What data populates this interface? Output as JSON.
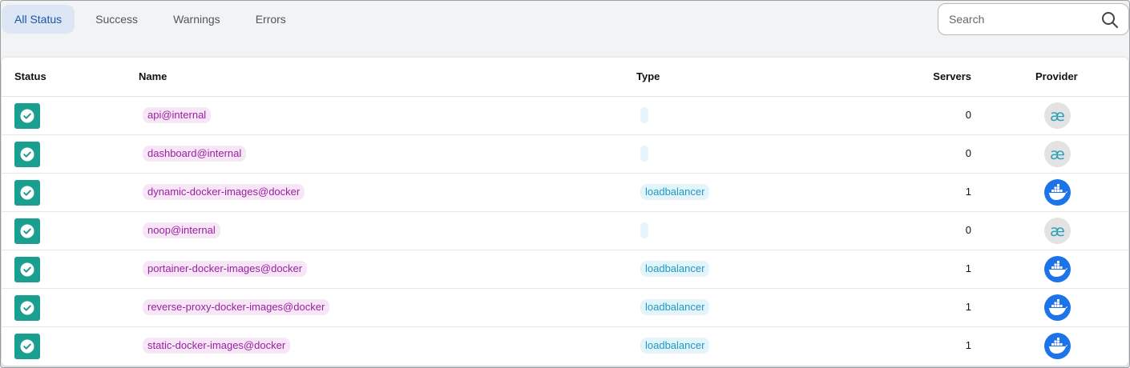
{
  "tabs": [
    {
      "label": "All Status",
      "active": true
    },
    {
      "label": "Success",
      "active": false
    },
    {
      "label": "Warnings",
      "active": false
    },
    {
      "label": "Errors",
      "active": false
    }
  ],
  "search": {
    "placeholder": "Search",
    "value": ""
  },
  "table": {
    "headers": {
      "status": "Status",
      "name": "Name",
      "type": "Type",
      "servers": "Servers",
      "provider": "Provider"
    },
    "rows": [
      {
        "status": "success",
        "name": "api@internal",
        "type": "",
        "servers": "0",
        "provider": "internal"
      },
      {
        "status": "success",
        "name": "dashboard@internal",
        "type": "",
        "servers": "0",
        "provider": "internal"
      },
      {
        "status": "success",
        "name": "dynamic-docker-images@docker",
        "type": "loadbalancer",
        "servers": "1",
        "provider": "docker"
      },
      {
        "status": "success",
        "name": "noop@internal",
        "type": "",
        "servers": "0",
        "provider": "internal"
      },
      {
        "status": "success",
        "name": "portainer-docker-images@docker",
        "type": "loadbalancer",
        "servers": "1",
        "provider": "docker"
      },
      {
        "status": "success",
        "name": "reverse-proxy-docker-images@docker",
        "type": "loadbalancer",
        "servers": "1",
        "provider": "docker"
      },
      {
        "status": "success",
        "name": "static-docker-images@docker",
        "type": "loadbalancer",
        "servers": "1",
        "provider": "docker"
      }
    ]
  },
  "colors": {
    "status_success": "#1a9e8f",
    "tab_active_bg": "#dde6f5",
    "name_chip_bg": "#f6e6f6",
    "name_chip_text": "#9a1fa4",
    "type_chip_bg": "#e3f4fa",
    "type_chip_text": "#1f98c4",
    "docker_blue": "#1d73e8"
  },
  "icons": {
    "search": "magnifier-icon",
    "status": "check-circle-icon",
    "internal_provider": "ae-ligature-icon",
    "docker_provider": "docker-whale-icon"
  }
}
